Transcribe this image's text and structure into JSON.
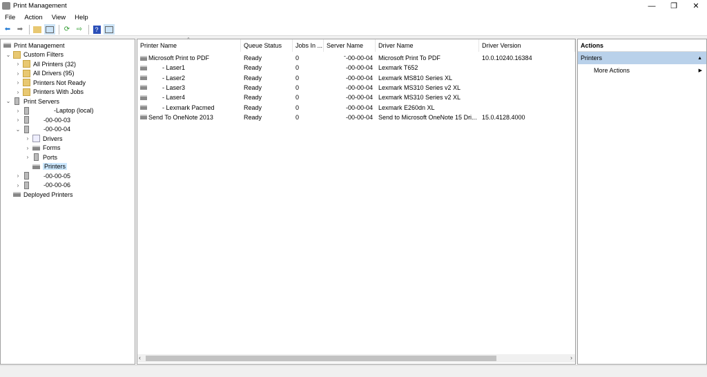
{
  "window": {
    "title": "Print Management",
    "minimize": "—",
    "restore": "❐",
    "close": "✕"
  },
  "menu": [
    "File",
    "Action",
    "View",
    "Help"
  ],
  "toolbar": [
    "back-icon",
    "forward-icon",
    "up-folder-icon",
    "show-hide-tree-icon",
    "refresh-icon",
    "export-list-icon",
    "help-icon",
    "show-hide-action-pane-icon"
  ],
  "tree": [
    {
      "label": "Print Management",
      "level": 0,
      "chev": "",
      "icon": "printer"
    },
    {
      "label": "Custom Filters",
      "level": 1,
      "chev": "⌄",
      "icon": "folder"
    },
    {
      "label": "All Printers (32)",
      "level": 2,
      "chev": "›",
      "icon": "folder"
    },
    {
      "label": "All Drivers (95)",
      "level": 2,
      "chev": "›",
      "icon": "folder"
    },
    {
      "label": "Printers Not Ready",
      "level": 2,
      "chev": "›",
      "icon": "folder"
    },
    {
      "label": "Printers With Jobs",
      "level": 2,
      "chev": "›",
      "icon": "folder"
    },
    {
      "label": "Print Servers",
      "level": 1,
      "chev": "⌄",
      "icon": "server"
    },
    {
      "label": "            -Laptop (local)",
      "level": 2,
      "chev": "›",
      "icon": "server"
    },
    {
      "label": "      -00-00-03",
      "level": 2,
      "chev": "›",
      "icon": "server"
    },
    {
      "label": "      -00-00-04",
      "level": 2,
      "chev": "⌄",
      "icon": "server"
    },
    {
      "label": "Drivers",
      "level": 3,
      "chev": "›",
      "icon": "drivers"
    },
    {
      "label": "Forms",
      "level": 3,
      "chev": "›",
      "icon": "forms"
    },
    {
      "label": "Ports",
      "level": 3,
      "chev": "›",
      "icon": "ports"
    },
    {
      "label": "Printers",
      "level": 3,
      "chev": "",
      "icon": "printer",
      "selected": true
    },
    {
      "label": "      -00-00-05",
      "level": 2,
      "chev": "›",
      "icon": "server"
    },
    {
      "label": "      -00-00-06",
      "level": 2,
      "chev": "›",
      "icon": "server"
    },
    {
      "label": "Deployed Printers",
      "level": 1,
      "chev": "",
      "icon": "printer"
    }
  ],
  "table": {
    "columns": [
      "Printer Name",
      "Queue Status",
      "Jobs In ...",
      "Server Name",
      "Driver Name",
      "Driver Version"
    ],
    "rows": [
      [
        "Microsoft Print to PDF",
        "Ready",
        "0",
        "ˉ-00-00-04",
        "Microsoft Print To PDF",
        "10.0.10240.16384"
      ],
      [
        "        - Laser1",
        "Ready",
        "0",
        "-00-00-04",
        "Lexmark T652",
        ""
      ],
      [
        "        - Laser2",
        "Ready",
        "0",
        "-00-00-04",
        "Lexmark MS810 Series XL",
        ""
      ],
      [
        "        - Laser3",
        "Ready",
        "0",
        "-00-00-04",
        "Lexmark MS310 Series v2 XL",
        ""
      ],
      [
        "        - Laser4",
        "Ready",
        "0",
        "-00-00-04",
        "Lexmark MS310 Series v2 XL",
        ""
      ],
      [
        "        - Lexmark Pacmed",
        "Ready",
        "0",
        "-00-00-04",
        "Lexmark E260dn XL",
        ""
      ],
      [
        "Send To OneNote 2013",
        "Ready",
        "0",
        "-00-00-04",
        "Send to Microsoft OneNote 15 Dri...",
        "15.0.4128.4000"
      ]
    ]
  },
  "actions": {
    "header": "Actions",
    "section": "Printers",
    "item": "More Actions"
  }
}
